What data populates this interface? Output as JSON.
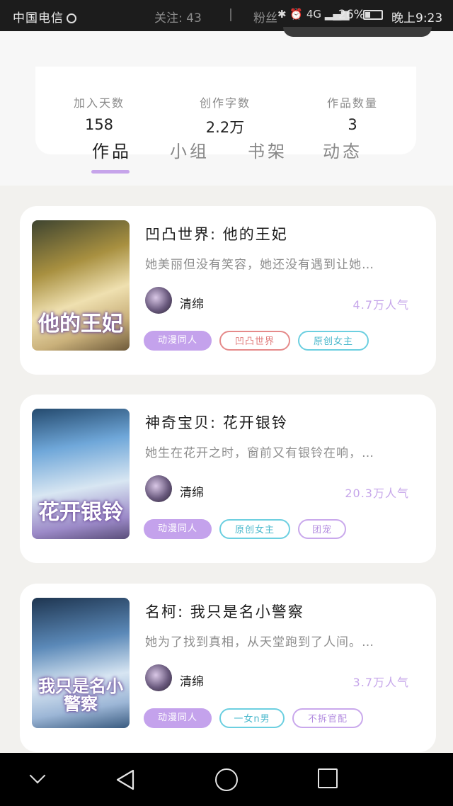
{
  "status_bar": {
    "carrier": "中国电信",
    "follow_text": "关注: 43",
    "fans_text": "粉丝",
    "network": "4G",
    "battery_percent": "26%",
    "time": "晚上9:23"
  },
  "stats": [
    {
      "label": "加入天数",
      "value": "158"
    },
    {
      "label": "创作字数",
      "value": "2.2万"
    },
    {
      "label": "作品数量",
      "value": "3"
    }
  ],
  "tabs": [
    {
      "label": "作品",
      "active": true
    },
    {
      "label": "小组",
      "active": false
    },
    {
      "label": "书架",
      "active": false
    },
    {
      "label": "动态",
      "active": false
    }
  ],
  "accent_color": "#c6a4ea",
  "books": [
    {
      "title": "凹凸世界: 他的王妃",
      "description": "她美丽但没有笑容，她还没有遇到让她…",
      "author": "清绵",
      "popularity": "4.7万人气",
      "cover_text": "他的王妃",
      "tags": [
        {
          "label": "动漫同人",
          "style": "filled",
          "color": "#c4a2ec"
        },
        {
          "label": "凹凸世界",
          "style": "outline",
          "color": "#e58a8a"
        },
        {
          "label": "原创女主",
          "style": "outline",
          "color": "#6ccfe0"
        }
      ]
    },
    {
      "title": "神奇宝贝: 花开银铃",
      "description": "她生在花开之时，窗前又有银铃在响，…",
      "author": "清绵",
      "popularity": "20.3万人气",
      "cover_text": "花开银铃",
      "tags": [
        {
          "label": "动漫同人",
          "style": "filled",
          "color": "#c4a2ec"
        },
        {
          "label": "原创女主",
          "style": "outline",
          "color": "#6ccfe0"
        },
        {
          "label": "团宠",
          "style": "outline",
          "color": "#c9a8ec"
        }
      ]
    },
    {
      "title": "名柯: 我只是名小警察",
      "description": "她为了找到真相，从天堂跑到了人间。…",
      "author": "清绵",
      "popularity": "3.7万人气",
      "cover_text": "我只是名小警察",
      "tags": [
        {
          "label": "动漫同人",
          "style": "filled",
          "color": "#c4a2ec"
        },
        {
          "label": "一女n男",
          "style": "outline",
          "color": "#6ccfe0"
        },
        {
          "label": "不拆官配",
          "style": "outline",
          "color": "#c9a8ec"
        }
      ]
    }
  ],
  "nav_icons": [
    "chevron-down-icon",
    "back-triangle-icon",
    "home-circle-icon",
    "recent-square-icon"
  ]
}
